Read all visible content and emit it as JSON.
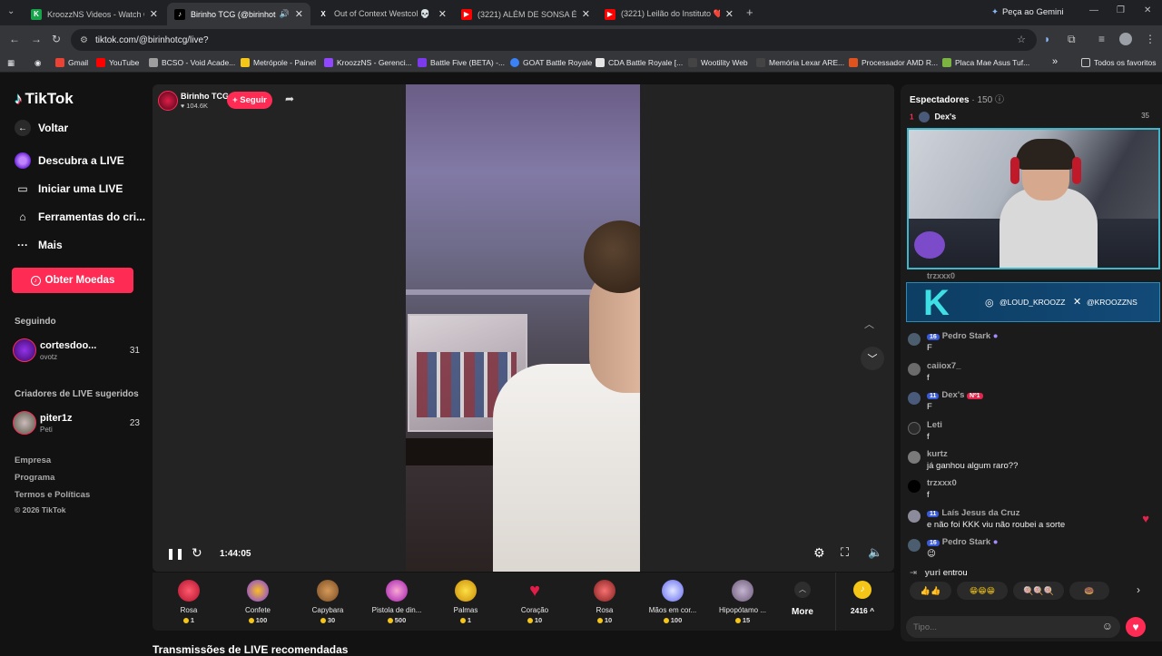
{
  "browser": {
    "tabs": [
      {
        "title": "KroozzNS Videos - Watch On-D",
        "favicon_color": "#22c55e",
        "favicon": "K"
      },
      {
        "title": "Birinho TCG (@birinhotcg) ·",
        "favicon_color": "#000000",
        "favicon": "♪"
      },
      {
        "title": "Out of Context Westcol 💀 no",
        "favicon_color": "#000000",
        "favicon": "X"
      },
      {
        "title": "(3221) ALÉM DE SONSA É BURR",
        "favicon_color": "#ff0000",
        "favicon": "▶"
      },
      {
        "title": "(3221) Leilão do Instituto ❤️ e",
        "favicon_color": "#ff0000",
        "favicon": "▶"
      }
    ],
    "new_tab": "+",
    "gemini_label": "Peça ao Gemini",
    "url": "tiktok.com/@birinhotcg/live?",
    "bookmarks": [
      {
        "label": "Gmail",
        "color": "#ea4335"
      },
      {
        "label": "YouTube",
        "color": "#ff0000"
      },
      {
        "label": "BCSO - Void Acade...",
        "color": "#9e9e9e"
      },
      {
        "label": "Metrópole - Painel",
        "color": "#f5c518"
      },
      {
        "label": "KroozzNS - Gerenci...",
        "color": "#9146ff"
      },
      {
        "label": "Battle Five (BETA) -...",
        "color": "#7c3aed"
      },
      {
        "label": "GOAT Battle Royale",
        "color": "#3b82f6"
      },
      {
        "label": "CDA Battle Royale [...",
        "color": "#e5e5e5"
      },
      {
        "label": "Wootility Web",
        "color": "#444444"
      },
      {
        "label": "Memória Lexar ARE...",
        "color": "#444444"
      },
      {
        "label": "Processador AMD R...",
        "color": "#e0531f"
      },
      {
        "label": "Placa Mae Asus Tuf...",
        "color": "#7cb342"
      }
    ],
    "more_bookmarks": "»",
    "all_favorites": "Todos os favoritos"
  },
  "sidebar": {
    "logo": "TikTok",
    "back": "Voltar",
    "nav": [
      {
        "label": "Descubra a LIVE",
        "icon": "live-discover-icon"
      },
      {
        "label": "Iniciar uma LIVE",
        "icon": "video-camera-icon"
      },
      {
        "label": "Ferramentas do cri...",
        "icon": "creator-tools-icon"
      },
      {
        "label": "Mais",
        "icon": "more-dots-icon"
      }
    ],
    "coins_button": "Obter Moedas",
    "following_title": "Seguindo",
    "following": [
      {
        "name": "cortesdoo...",
        "sub": "ovotz",
        "count": "31"
      }
    ],
    "suggested_title": "Criadores de LIVE sugeridos",
    "suggested": [
      {
        "name": "piter1z",
        "sub": "Peti",
        "count": "23"
      }
    ],
    "footer": [
      "Empresa",
      "Programa",
      "Termos e Políticas",
      "© 2026 TikTok"
    ]
  },
  "stream": {
    "host_name": "Birinho TCG",
    "likes": "104.6K",
    "follow_label": "+ Seguir",
    "time": "1:44:05",
    "recommended_title": "Transmissões de LIVE recomendadas"
  },
  "gifts": [
    {
      "name": "Rosa",
      "price": "1",
      "color": "#e0314b"
    },
    {
      "name": "Confete",
      "price": "100",
      "color": "#8b5cf6"
    },
    {
      "name": "Capybara",
      "price": "30",
      "color": "#b07a3a"
    },
    {
      "name": "Pistola de din...",
      "price": "500",
      "color": "#e879f9"
    },
    {
      "name": "Palmas",
      "price": "1",
      "color": "#f5c518"
    },
    {
      "name": "Coração",
      "price": "10",
      "color": "#e11d48"
    },
    {
      "name": "Rosa",
      "price": "10",
      "color": "#dc2626"
    },
    {
      "name": "Mãos em cor...",
      "price": "100",
      "color": "#a5b4fc"
    },
    {
      "name": "Hipopótamo ...",
      "price": "15",
      "color": "#9d8aa8"
    }
  ],
  "gift_more": "More",
  "coin_balance": "2416",
  "chat": {
    "viewers_label": "Espectadores",
    "viewers_count": "· 150",
    "top_rank": "1",
    "top_user": "Dex's",
    "top_score": "35",
    "overlay_handle_ig": "@LOUD_KROOZZ",
    "overlay_handle_x": "@KROOZZNS",
    "scrolled_user": "trzxxx0",
    "messages": [
      {
        "badge": "16",
        "user": "Pedro Stark",
        "text": "F"
      },
      {
        "badge": "",
        "user": "caiiox7_",
        "text": "f"
      },
      {
        "badge": "11",
        "user": "Dex's",
        "text": "F",
        "extra": "Nº1"
      },
      {
        "badge": "",
        "user": "Leti",
        "text": "f"
      },
      {
        "badge": "",
        "user": "kurtz",
        "text": "já ganhou algum raro??"
      },
      {
        "badge": "",
        "user": "trzxxx0",
        "text": "f"
      },
      {
        "badge": "11",
        "user": "Laís Jesus da Cruz",
        "text": "e não foi KKK viu não roubei a sorte"
      },
      {
        "badge": "16",
        "user": "Pedro Stark",
        "text": "😉"
      }
    ],
    "join_user": "yuri",
    "join_text": "entrou",
    "reactions": [
      "👍👍",
      "😁😁😁",
      "🍭🍭🍭",
      "🍩"
    ],
    "input_placeholder": "Tipo..."
  }
}
